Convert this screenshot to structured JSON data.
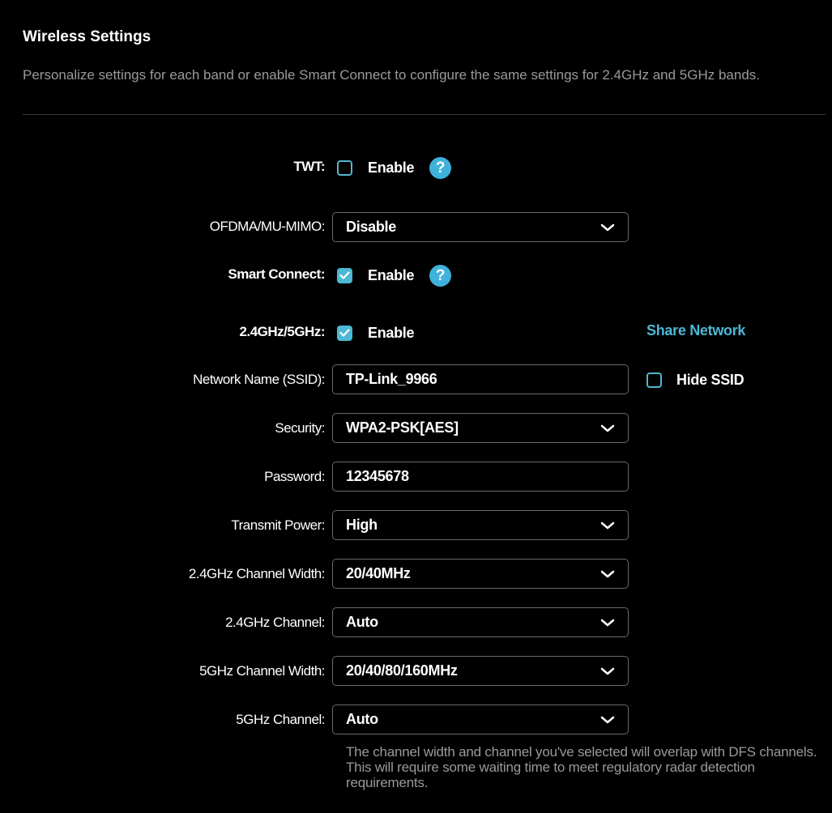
{
  "header": {
    "title": "Wireless Settings",
    "description": "Personalize settings for each band or enable Smart Connect to configure the same settings for 2.4GHz and 5GHz bands."
  },
  "colors": {
    "background": "#000000",
    "accent": "#4cb8d6",
    "muted_text": "#9a9a9a",
    "field_border": "#6a6a6a"
  },
  "twt": {
    "label": "TWT:",
    "checkbox_label": "Enable",
    "checked": false,
    "help_icon": "question-mark-icon",
    "help_glyph": "?"
  },
  "ofdma": {
    "label": "OFDMA/MU-MIMO:",
    "value": "Disable",
    "icon": "chevron-down-icon"
  },
  "smart_connect": {
    "label": "Smart Connect:",
    "checkbox_label": "Enable",
    "checked": true,
    "help_icon": "question-mark-icon",
    "help_glyph": "?"
  },
  "band": {
    "label": "2.4GHz/5GHz:",
    "checkbox_label": "Enable",
    "checked": true,
    "share_link": "Share Network"
  },
  "ssid": {
    "label": "Network Name (SSID):",
    "value": "TP-Link_9966",
    "hide_label": "Hide SSID",
    "hide_checked": false
  },
  "security": {
    "label": "Security:",
    "value": "WPA2-PSK[AES]"
  },
  "password": {
    "label": "Password:",
    "value": "12345678"
  },
  "transmit_power": {
    "label": "Transmit Power:",
    "value": "High"
  },
  "channel_width_24": {
    "label": "2.4GHz Channel Width:",
    "value": "20/40MHz"
  },
  "channel_24": {
    "label": "2.4GHz Channel:",
    "value": "Auto"
  },
  "channel_width_5": {
    "label": "5GHz Channel Width:",
    "value": "20/40/80/160MHz"
  },
  "channel_5": {
    "label": "5GHz Channel:",
    "value": "Auto"
  },
  "dfs_note": "The channel width and channel you've selected will overlap with DFS channels. This will require some waiting time to meet regulatory radar detection requirements."
}
